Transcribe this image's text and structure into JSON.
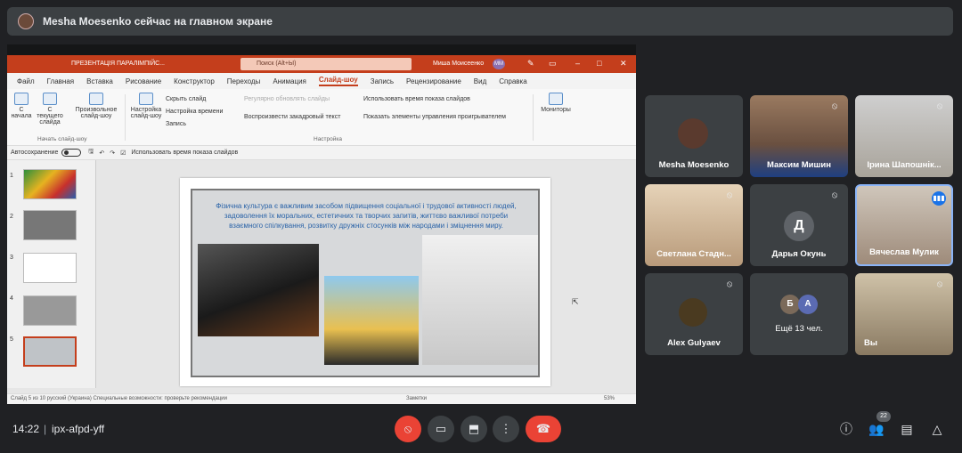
{
  "banner": {
    "text": "Mesha Moesenko сейчас на главном экране",
    "avatar": "person-avatar"
  },
  "ppt": {
    "title": "ПРЕЗЕНТАЦІЯ ПАРАЛІМПІЙС...",
    "search_placeholder": "Поиск (Alt+Ы)",
    "user": "Миша Моисеенко",
    "user_initials": "ММ",
    "menu": [
      "Файл",
      "Главная",
      "Вставка",
      "Рисование",
      "Конструктор",
      "Переходы",
      "Анимация",
      "Слайд-шоу",
      "Запись",
      "Рецензирование",
      "Вид",
      "Справка"
    ],
    "active_menu": "Слайд-шоу",
    "ribbon": {
      "from_start": "С начала",
      "from_current": "С текущего слайда",
      "custom_show": "Произвольное слайд-шоу",
      "group_start": "Начать слайд-шоу",
      "setup_show": "Настройка слайд-шоу",
      "hide_slide": "Скрыть слайд",
      "rehearse": "Настройка времени",
      "record": "Запись",
      "regular_refresh": "Регулярно обновлять слайды",
      "play_narrations": "Воспроизвести закадровый текст",
      "use_timings": "Использовать время показа слайдов",
      "show_media_controls": "Показать элементы управления проигрывателем",
      "group_setup": "Настройка",
      "monitors": "Мониторы"
    },
    "qat": {
      "autosave": "Автосохранение",
      "use_timings": "Использовать время показа слайдов"
    },
    "slide_numbers": [
      "1",
      "2",
      "3",
      "4",
      "5"
    ],
    "slide_text": "Фізична культура є важливим засобом підвищення соціальної і трудової активності людей, задоволення їх моральних, естетичних та творчих запитів, життєво важливої потреби взаємного спілкування, розвитку дружніх стосунків між народами і зміцнення миру.",
    "status": "Слайд 5 из 10    русский (Украина)    Специальные возможности: проверьте рекомендации",
    "notes": "Заметки",
    "zoom": "53%"
  },
  "participants": [
    {
      "name": "Mesha Moesenko",
      "muted": false
    },
    {
      "name": "Максим Мишин",
      "muted": true
    },
    {
      "name": "Ірина Шапошнік...",
      "muted": true
    },
    {
      "name": "Светлана Стадн...",
      "muted": true
    },
    {
      "name": "Дарья Окунь",
      "initial": "Д",
      "muted": true
    },
    {
      "name": "Вячеслав Мулик",
      "muted": false,
      "speaking": true
    },
    {
      "name": "Alex Gulyaev",
      "muted": true
    },
    {
      "name": "Ещё 13 чел.",
      "initials": [
        "Б",
        "А"
      ]
    },
    {
      "name": "Вы",
      "muted": true
    }
  ],
  "bottom": {
    "time": "14:22",
    "divider": "|",
    "meeting_code": "ipx-afpd-yff",
    "people_count": "22"
  },
  "colors": {
    "ppt_accent": "#c43e1c",
    "end_call": "#ea4335",
    "speaking": "#8ab4f8"
  }
}
